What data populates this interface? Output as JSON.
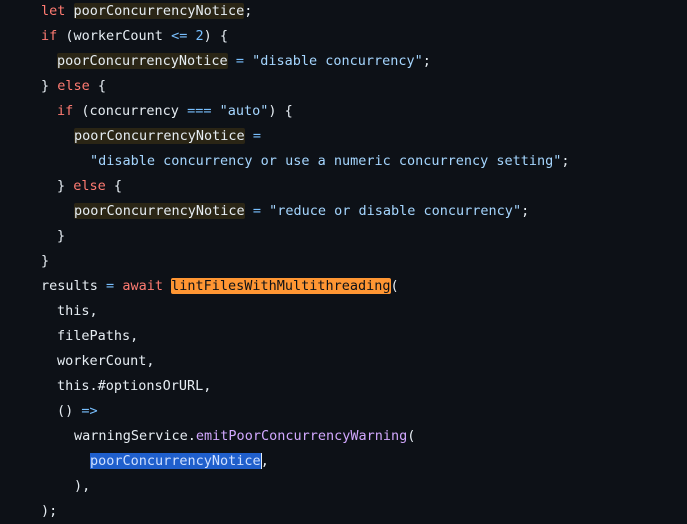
{
  "code": {
    "l1": {
      "kw": "let",
      "sp": " ",
      "var": "poorConcurrencyNotice",
      "end": ";"
    },
    "l2": {
      "kw": "if",
      "a": " (workerCount ",
      "op": "<=",
      "sp": " ",
      "num": "2",
      "end": ") {"
    },
    "l3": {
      "var": "poorConcurrencyNotice",
      "sp1": " ",
      "op": "=",
      "sp2": " ",
      "str": "\"disable concurrency\"",
      "end": ";"
    },
    "l4": {
      "a": "} ",
      "kw": "else",
      "end": " {"
    },
    "l5": {
      "kw": "if",
      "a": " (concurrency ",
      "op": "===",
      "sp": " ",
      "str": "\"auto\"",
      "end": ") {"
    },
    "l6": {
      "var": "poorConcurrencyNotice",
      "sp": " ",
      "op": "="
    },
    "l7": {
      "str": "\"disable concurrency or use a numeric concurrency setting\"",
      "end": ";"
    },
    "l8": {
      "a": "} ",
      "kw": "else",
      "end": " {"
    },
    "l9": {
      "var": "poorConcurrencyNotice",
      "sp1": " ",
      "op": "=",
      "sp2": " ",
      "str": "\"reduce or disable concurrency\"",
      "end": ";"
    },
    "l10": {
      "text": "}"
    },
    "l11": {
      "text": "}"
    },
    "l12": {
      "a": "results ",
      "op": "=",
      "sp": " ",
      "kw": "await",
      "sp2": " ",
      "fn": "lintFilesWithMultithreading",
      "end": "("
    },
    "l13": {
      "text": "this,"
    },
    "l14": {
      "text": "filePaths,"
    },
    "l15": {
      "text": "workerCount,"
    },
    "l16": {
      "text": "this.#optionsOrURL,"
    },
    "l17": {
      "a": "() ",
      "op": "=>"
    },
    "l18": {
      "a": "warningService.",
      "fn": "emitPoorConcurrencyWarning",
      "end": "("
    },
    "l19": {
      "sel": "poorConcurrencyNotice",
      "end": ","
    },
    "l20": {
      "text": "),"
    },
    "l21": {
      "text": ");"
    }
  },
  "colors": {
    "background": "#0d1117",
    "keyword": "#ff7b72",
    "string": "#a5d6ff",
    "operator": "#79c0ff",
    "function": "#d2a8ff",
    "find_highlight": "#ff9633",
    "selection": "#1f5fcc"
  }
}
